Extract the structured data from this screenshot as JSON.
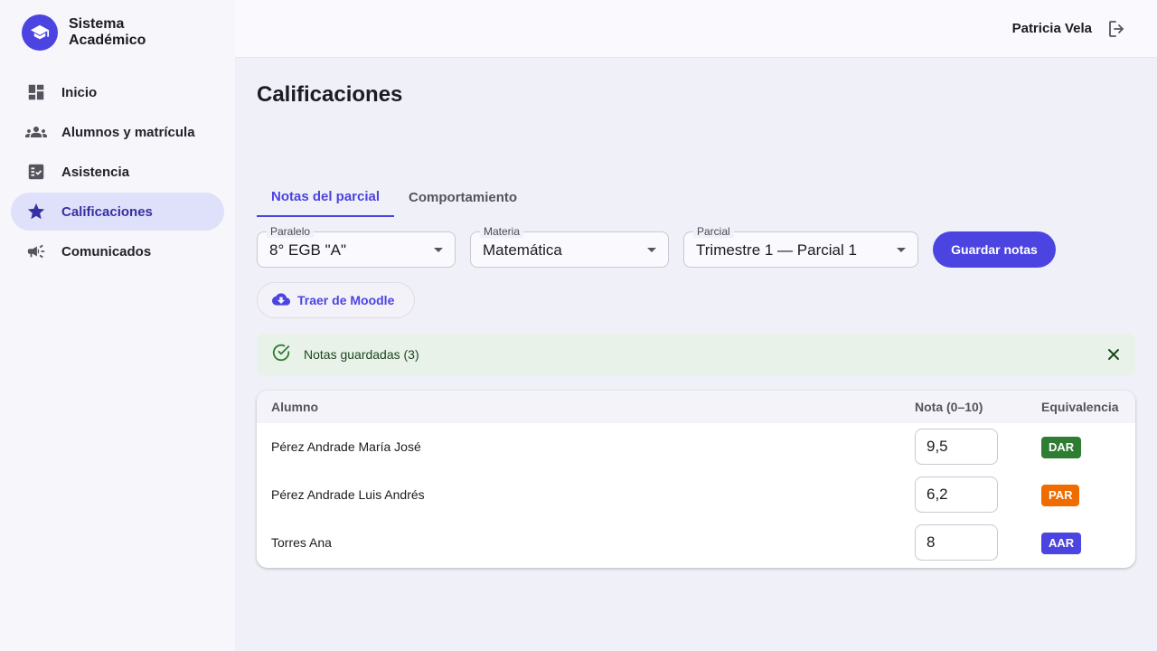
{
  "brand": {
    "name": "Sistema Académico"
  },
  "sidebar": {
    "items": [
      {
        "label": "Inicio",
        "icon": "dashboard-icon"
      },
      {
        "label": "Alumnos y matrícula",
        "icon": "people-icon"
      },
      {
        "label": "Asistencia",
        "icon": "checklist-icon"
      },
      {
        "label": "Calificaciones",
        "icon": "star-icon",
        "active": true
      },
      {
        "label": "Comunicados",
        "icon": "megaphone-icon"
      }
    ]
  },
  "header": {
    "user_name": "Patricia Vela"
  },
  "page": {
    "title": "Calificaciones",
    "tabs": [
      {
        "label": "Notas del parcial",
        "active": true
      },
      {
        "label": "Comportamiento"
      }
    ],
    "filters": {
      "paralelo": {
        "label": "Paralelo",
        "value": "8° EGB \"A\""
      },
      "materia": {
        "label": "Materia",
        "value": "Matemática"
      },
      "parcial": {
        "label": "Parcial",
        "value": "Trimestre 1 — Parcial 1"
      }
    },
    "save_label": "Guardar notas",
    "moodle_label": "Traer de Moodle",
    "alert": {
      "text": "Notas guardadas (3)"
    },
    "table": {
      "columns": [
        "Alumno",
        "Nota (0–10)",
        "Equivalencia"
      ],
      "rows": [
        {
          "name": "Pérez Andrade María José",
          "grade": "9,5",
          "equivalence": "DAR",
          "color": "#2e7d32"
        },
        {
          "name": "Pérez Andrade Luis Andrés",
          "grade": "6,2",
          "equivalence": "PAR",
          "color": "#ef6c00"
        },
        {
          "name": "Torres Ana",
          "grade": "8",
          "equivalence": "AAR",
          "color": "#4b44e0"
        }
      ]
    }
  },
  "colors": {
    "accent": "#4b44e0",
    "success_bg": "#e8f2e8",
    "success_fg": "#2e7d32"
  }
}
